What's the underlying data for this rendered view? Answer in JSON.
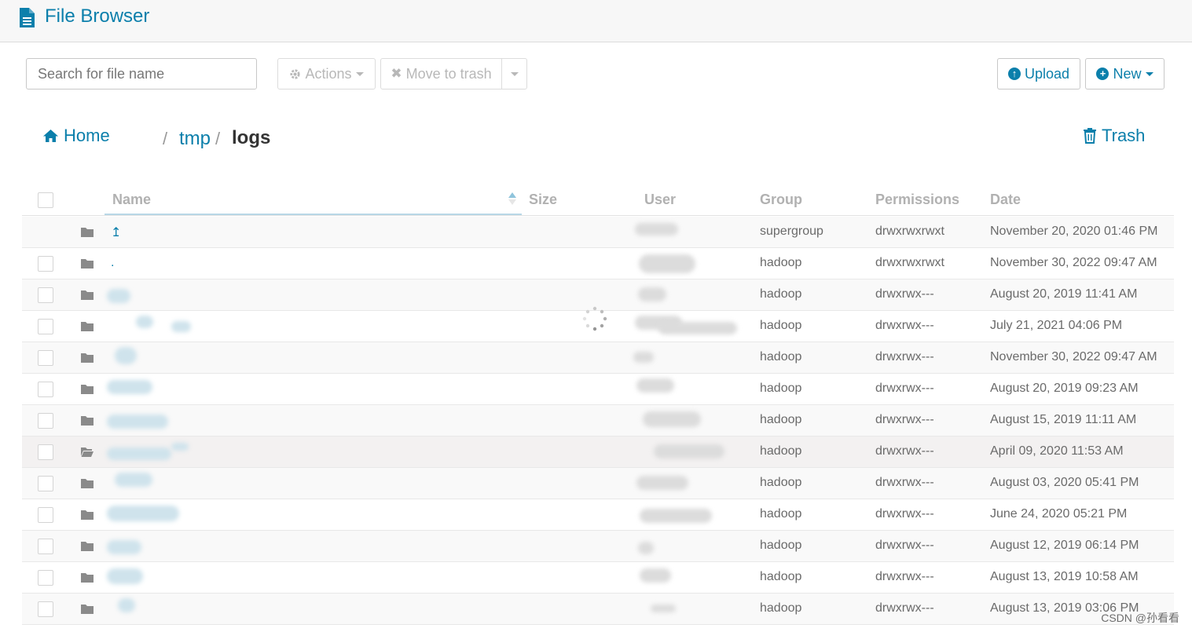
{
  "app": {
    "title": "File Browser"
  },
  "toolbar": {
    "search_placeholder": "Search for file name",
    "actions_label": "Actions",
    "move_to_trash_label": "Move to trash",
    "upload_label": "Upload",
    "new_label": "New"
  },
  "breadcrumb": {
    "home": "Home",
    "sep": "/",
    "items": [
      "tmp",
      "logs"
    ]
  },
  "trash_label": "Trash",
  "table": {
    "columns": [
      "Name",
      "Size",
      "User",
      "Group",
      "Permissions",
      "Date"
    ],
    "sort": {
      "column": "Name",
      "direction": "ascending"
    },
    "rows": [
      {
        "name": "↥",
        "group": "supergroup",
        "permissions": "drwxrwxrwxt",
        "date": "November 20, 2020 01:46 PM",
        "folder": "closed"
      },
      {
        "name": ".",
        "group": "hadoop",
        "permissions": "drwxrwxrwxt",
        "date": "November 30, 2022 09:47 AM",
        "folder": "closed"
      },
      {
        "name": "",
        "group": "hadoop",
        "permissions": "drwxrwx---",
        "date": "August 20, 2019 11:41 AM",
        "folder": "closed"
      },
      {
        "name": "",
        "group": "hadoop",
        "permissions": "drwxrwx---",
        "date": "July 21, 2021 04:06 PM",
        "folder": "closed"
      },
      {
        "name": "",
        "group": "hadoop",
        "permissions": "drwxrwx---",
        "date": "November 30, 2022 09:47 AM",
        "folder": "closed"
      },
      {
        "name": "",
        "group": "hadoop",
        "permissions": "drwxrwx---",
        "date": "August 20, 2019 09:23 AM",
        "folder": "closed"
      },
      {
        "name": "",
        "group": "hadoop",
        "permissions": "drwxrwx---",
        "date": "August 15, 2019 11:11 AM",
        "folder": "closed"
      },
      {
        "name": "",
        "group": "hadoop",
        "permissions": "drwxrwx---",
        "date": "April 09, 2020 11:53 AM",
        "folder": "open"
      },
      {
        "name": "",
        "group": "hadoop",
        "permissions": "drwxrwx---",
        "date": "August 03, 2020 05:41 PM",
        "folder": "closed"
      },
      {
        "name": "",
        "group": "hadoop",
        "permissions": "drwxrwx---",
        "date": "June 24, 2020 05:21 PM",
        "folder": "closed"
      },
      {
        "name": "",
        "group": "hadoop",
        "permissions": "drwxrwx---",
        "date": "August 12, 2019 06:14 PM",
        "folder": "closed"
      },
      {
        "name": "",
        "group": "hadoop",
        "permissions": "drwxrwx---",
        "date": "August 13, 2019 10:58 AM",
        "folder": "closed"
      },
      {
        "name": "",
        "group": "hadoop",
        "permissions": "drwxrwx---",
        "date": "August 13, 2019 03:06 PM",
        "folder": "closed"
      }
    ]
  },
  "watermark": "CSDN @孙看看",
  "colors": {
    "accent": "#0b7fab",
    "muted": "#b1b1b1"
  }
}
